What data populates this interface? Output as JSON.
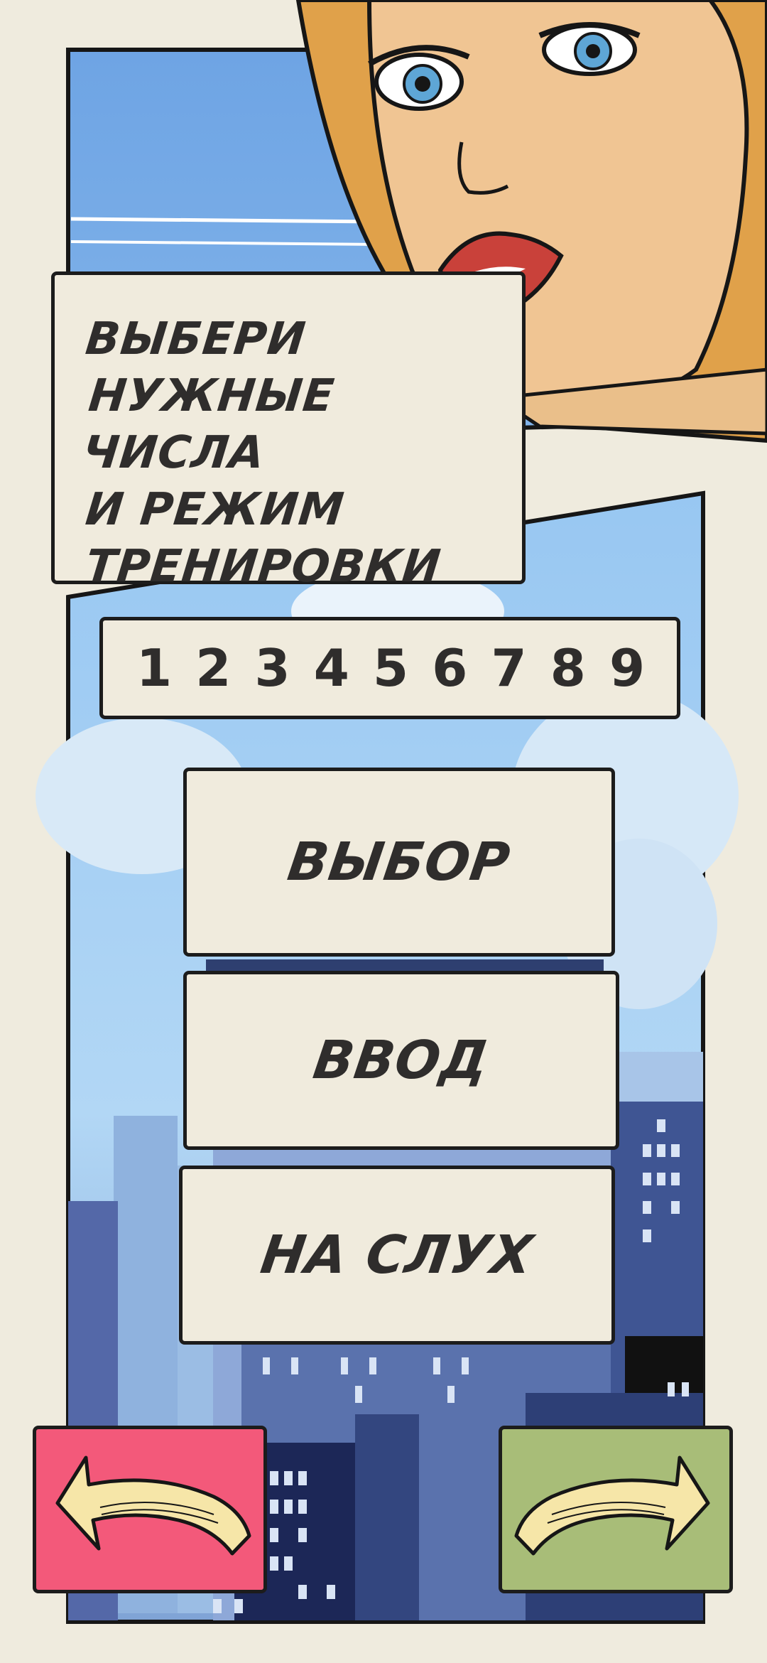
{
  "title_lines": [
    "Выбери",
    "нужные числа",
    "и режим",
    "тренировки"
  ],
  "numbers": [
    "1",
    "2",
    "3",
    "4",
    "5",
    "6",
    "7",
    "8",
    "9"
  ],
  "modes": {
    "choice": "ВЫБОР",
    "input": "ВВОД",
    "ear": "НА СЛУХ"
  },
  "colors": {
    "background": "#efebde",
    "panel": "#f0ebdd",
    "back_button": "#f3597a",
    "next_button": "#a8bd78",
    "text": "#2f2d2c"
  },
  "icons": {
    "back": "curved-arrow-left-icon",
    "next": "curved-arrow-right-icon"
  }
}
